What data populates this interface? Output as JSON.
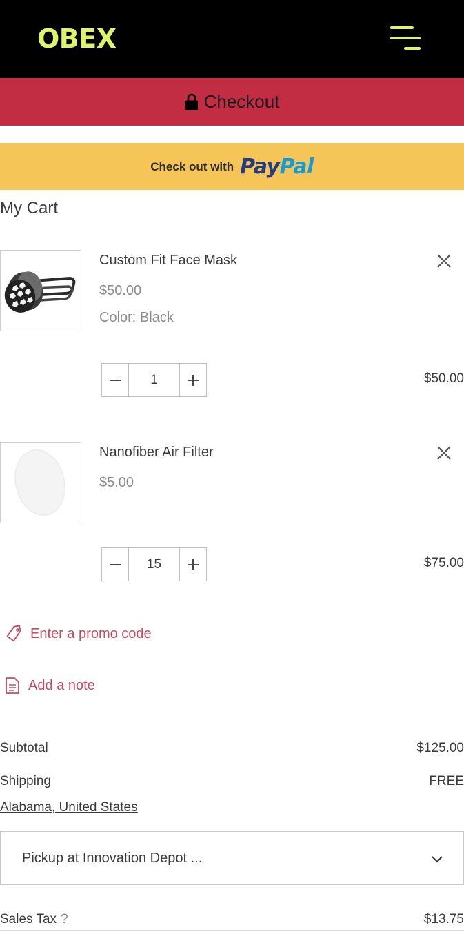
{
  "header": {
    "logo": "OBEX",
    "menu_icon": "menu-icon",
    "background": "#000000",
    "accent": "#dcf36c"
  },
  "checkout": {
    "label": "Checkout",
    "icon": "lock-icon",
    "background": "#c32d44"
  },
  "paypal": {
    "prefix": "Check out with",
    "brand_pay": "Pay",
    "brand_pal": "Pal",
    "background": "#f5c557"
  },
  "cart": {
    "title": "My Cart",
    "items": [
      {
        "name": "Custom Fit Face Mask",
        "price": "$50.00",
        "option": "Color: Black",
        "quantity": "1",
        "total": "$50.00",
        "image": "face-mask-image"
      },
      {
        "name": "Nanofiber Air Filter",
        "price": "$5.00",
        "quantity": "15",
        "total": "$75.00",
        "image": "air-filter-image"
      }
    ]
  },
  "actions": {
    "promo_label": "Enter a promo code",
    "note_label": "Add a note",
    "link_color": "#c54b5c"
  },
  "summary": {
    "subtotal_label": "Subtotal",
    "subtotal_value": "$125.00",
    "shipping_label": "Shipping",
    "shipping_value": "FREE",
    "location": "Alabama, United States",
    "shipping_option": "Pickup at Innovation Depot ...",
    "tax_label": "Sales Tax",
    "tax_help": "?",
    "tax_value": "$13.75"
  }
}
